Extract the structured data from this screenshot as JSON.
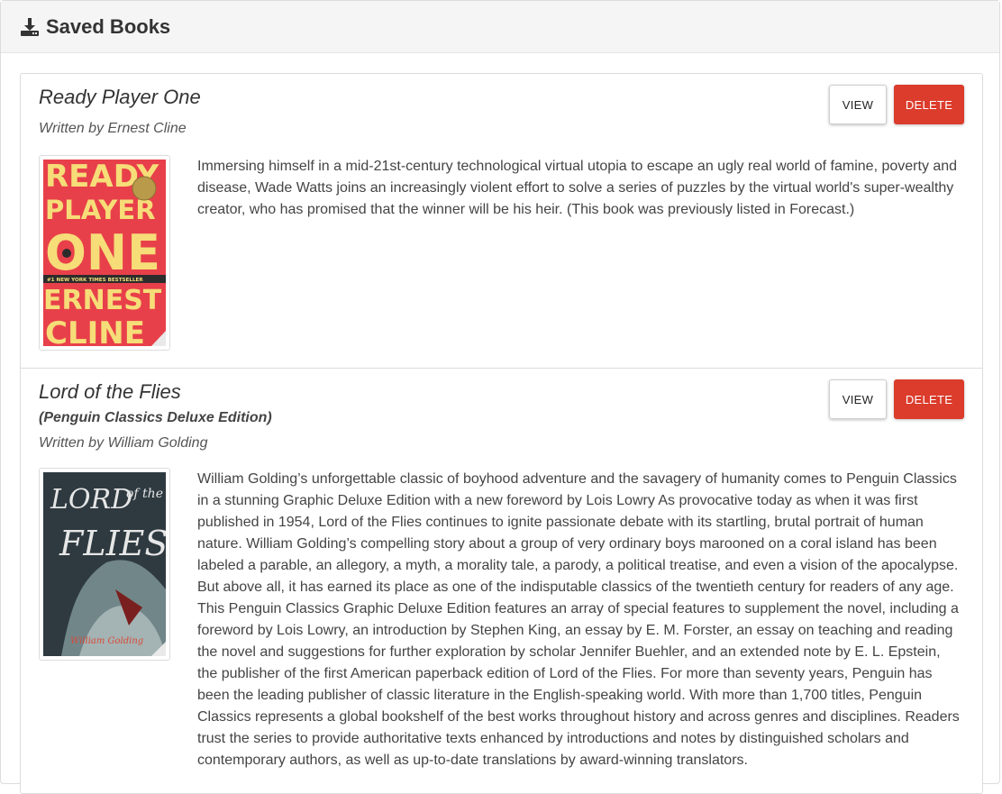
{
  "header": {
    "title": "Saved Books",
    "icon": "download-icon"
  },
  "books": [
    {
      "title": "Ready Player One",
      "subtitle": "",
      "author": "Written by Ernest Cline",
      "view_label": "VIEW",
      "delete_label": "DELETE",
      "description": "Immersing himself in a mid-21st-century technological virtual utopia to escape an ugly real world of famine, poverty and disease, Wade Watts joins an increasingly violent effort to solve a series of puzzles by the virtual world's super-wealthy creator, who has promised that the winner will be his heir. (This book was previously listed in Forecast.)",
      "cover_text": [
        "READY",
        "PLAYER",
        "ONE",
        "#1 NEW YORK TIMES BESTSELLER",
        "ERNEST",
        "CLINE"
      ]
    },
    {
      "title": "Lord of the Flies",
      "subtitle": "(Penguin Classics Deluxe Edition)",
      "author": "Written by William Golding",
      "view_label": "VIEW",
      "delete_label": "DELETE",
      "description": "William Golding’s unforgettable classic of boyhood adventure and the savagery of humanity comes to Penguin Classics in a stunning Graphic Deluxe Edition with a new foreword by Lois Lowry As provocative today as when it was first published in 1954, Lord of the Flies continues to ignite passionate debate with its startling, brutal portrait of human nature. William Golding’s compelling story about a group of very ordinary boys marooned on a coral island has been labeled a parable, an allegory, a myth, a morality tale, a parody, a political treatise, and even a vision of the apocalypse. But above all, it has earned its place as one of the indisputable classics of the twentieth century for readers of any age. This Penguin Classics Graphic Deluxe Edition features an array of special features to supplement the novel, including a foreword by Lois Lowry, an introduction by Stephen King, an essay by E. M. Forster, an essay on teaching and reading the novel and suggestions for further exploration by scholar Jennifer Buehler, and an extended note by E. L. Epstein, the publisher of the first American paperback edition of Lord of the Flies. For more than seventy years, Penguin has been the leading publisher of classic literature in the English-speaking world. With more than 1,700 titles, Penguin Classics represents a global bookshelf of the best works throughout history and across genres and disciplines. Readers trust the series to provide authoritative texts enhanced by introductions and notes by distinguished scholars and contemporary authors, as well as up-to-date translations by award-winning translators.",
      "cover_text": [
        "LORD",
        "of the",
        "FLIES",
        "William Golding"
      ]
    }
  ],
  "colors": {
    "delete": "#db3c2c",
    "header_bg": "#f5f5f5",
    "rpo_cover_bg": "#e8404a",
    "rpo_cover_text": "#f6dd78",
    "lotf_cover_bg": "#2e3a40"
  }
}
